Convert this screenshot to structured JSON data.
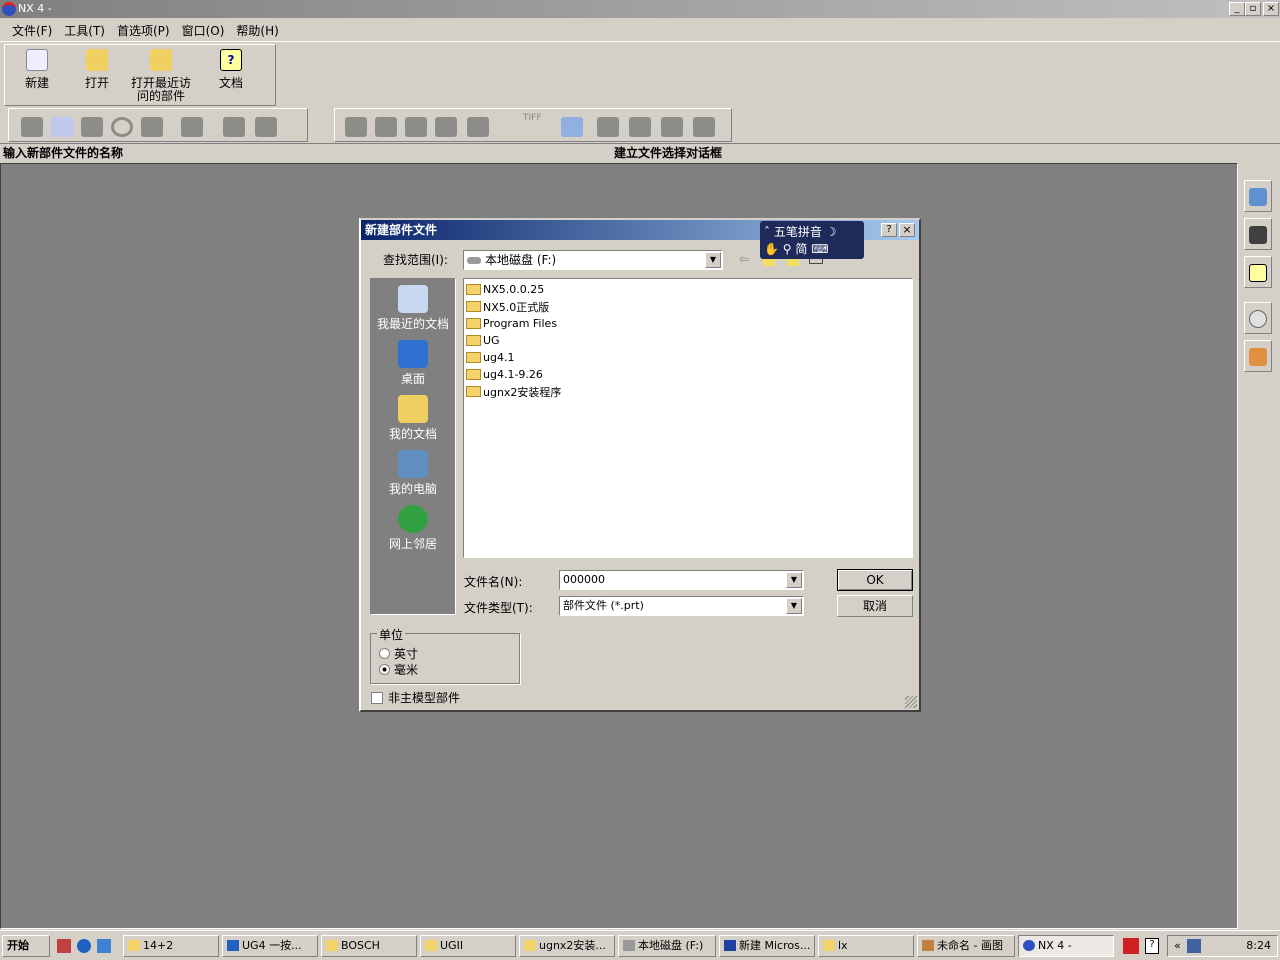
{
  "window": {
    "title": "NX 4 -",
    "min": "_",
    "max": "▫",
    "close": "×"
  },
  "menu": [
    "文件(F)",
    "工具(T)",
    "首选项(P)",
    "窗口(O)",
    "帮助(H)"
  ],
  "toolbar": {
    "new": "新建",
    "open": "打开",
    "recent": "打开最近访问的部件",
    "docs": "文档",
    "tiff": "TIFF"
  },
  "status": {
    "left": "输入新部件文件的名称",
    "right": "建立文件选择对话框"
  },
  "dialog": {
    "title": "新建部件文件",
    "help": "?",
    "close": "×",
    "lookin_label": "查找范围(I):",
    "lookin_value": "本地磁盘 (F:)",
    "places": [
      "我最近的文档",
      "桌面",
      "我的文档",
      "我的电脑",
      "网上邻居"
    ],
    "files": [
      "NX5.0.0.25",
      "NX5.0正式版",
      "Program Files",
      "UG",
      "ug4.1",
      "ug4.1-9.26",
      "ugnx2安装程序"
    ],
    "filename_label": "文件名(N):",
    "filename_value": "000000",
    "filetype_label": "文件类型(T):",
    "filetype_value": "部件文件 (*.prt)",
    "ok": "OK",
    "cancel": "取消",
    "units_label": "单位",
    "unit_inch": "英寸",
    "unit_mm": "毫米",
    "selected_unit": "毫米",
    "non_master": "非主模型部件",
    "non_master_checked": false
  },
  "ime": {
    "name": "五笔拼音",
    "mode": "简"
  },
  "taskbar": {
    "start": "开始",
    "tasks": [
      "14+2",
      "UG4 一按...",
      "BOSCH",
      "UGII",
      "ugnx2安装...",
      "本地磁盘 (F:)",
      "新建 Micros...",
      "lx",
      "未命名 - 画图",
      "NX 4 -"
    ],
    "active": "NX 4 -",
    "clock": "8:24"
  }
}
